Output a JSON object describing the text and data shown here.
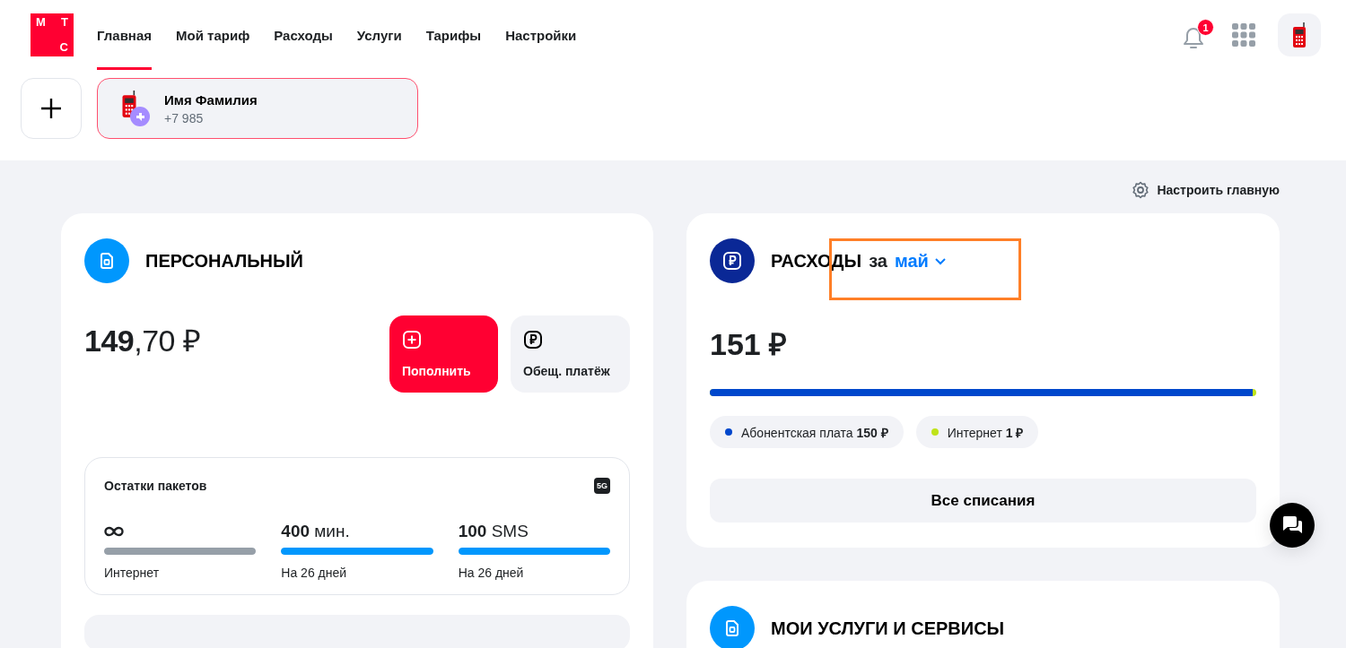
{
  "logo": {
    "letters": [
      "М",
      "Т",
      "С"
    ]
  },
  "nav": [
    {
      "label": "Главная",
      "selected": true
    },
    {
      "label": "Мой тариф",
      "selected": false
    },
    {
      "label": "Расходы",
      "selected": false
    },
    {
      "label": "Услуги",
      "selected": false
    },
    {
      "label": "Тарифы",
      "selected": false
    },
    {
      "label": "Настройки",
      "selected": false
    }
  ],
  "notifications": {
    "count": "1"
  },
  "account": {
    "name": "Имя Фамилия",
    "phone": "+7 985",
    "selected": true
  },
  "customize_link": "Настроить главную",
  "tariff_card": {
    "title": "ПЕРСОНАЛЬНЫЙ",
    "balance": "**149**,70 ₽",
    "buttons": [
      {
        "label": "Пополнить",
        "kind": "primary"
      },
      {
        "label": "Обещ. платёж",
        "kind": "secondary"
      }
    ],
    "packages": {
      "title": "Остатки пакетов",
      "badge": "5G",
      "items": [
        {
          "kind": "unlimited",
          "value": "",
          "caption": "Интернет",
          "level": 1
        },
        {
          "kind": "amount",
          "value": "**400** мин.",
          "caption": "На 26 дней",
          "level": 1
        },
        {
          "kind": "amount",
          "value": "**100** SMS",
          "caption": "На 26 дней",
          "level": 1
        }
      ]
    }
  },
  "spending_card": {
    "title": "РАСХОДЫ",
    "period_prefix": "за",
    "period": "май",
    "total": "151 ₽",
    "bar": {
      "level": 0.993
    },
    "items": [
      {
        "label": "Абонентская плата **150 ₽**",
        "color": "#0047cc"
      },
      {
        "label": "Интернет **1 ₽**",
        "color": "#bfe31a"
      }
    ],
    "all_button": "Все списания"
  },
  "services_card": {
    "title": "МОИ УСЛУГИ И СЕРВИСЫ"
  }
}
